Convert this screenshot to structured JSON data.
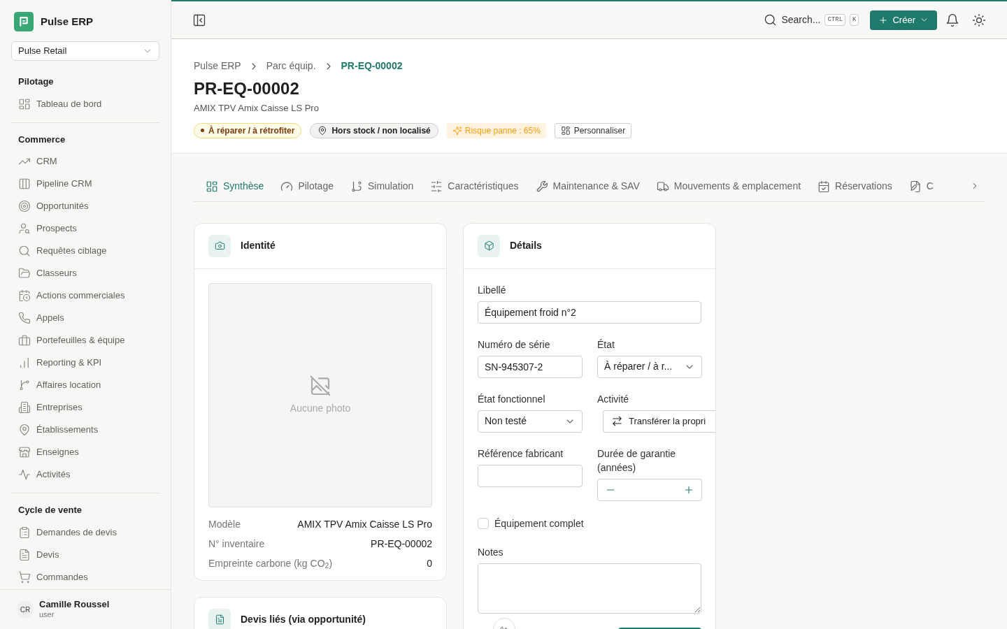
{
  "app": {
    "name": "Pulse ERP"
  },
  "workspace_select": {
    "value": "Pulse Retail"
  },
  "sidebar": {
    "sections": [
      {
        "title": "Pilotage",
        "items": [
          {
            "label": "Tableau de bord"
          }
        ]
      },
      {
        "title": "Commerce",
        "items": [
          {
            "label": "CRM"
          },
          {
            "label": "Pipeline CRM"
          },
          {
            "label": "Opportunités"
          },
          {
            "label": "Prospects"
          },
          {
            "label": "Requêtes ciblage"
          },
          {
            "label": "Classeurs"
          },
          {
            "label": "Actions commerciales"
          },
          {
            "label": "Appels"
          },
          {
            "label": "Portefeuilles & équipe"
          },
          {
            "label": "Reporting & KPI"
          },
          {
            "label": "Affaires location"
          },
          {
            "label": "Entreprises"
          },
          {
            "label": "Établissements"
          },
          {
            "label": "Enseignes"
          },
          {
            "label": "Activités"
          }
        ]
      },
      {
        "title": "Cycle de vente",
        "items": [
          {
            "label": "Demandes de devis"
          },
          {
            "label": "Devis"
          },
          {
            "label": "Commandes"
          }
        ]
      }
    ]
  },
  "user": {
    "initials": "CR",
    "name": "Camille Roussel",
    "role": "user"
  },
  "topbar": {
    "search": "Search...",
    "shortcut": [
      "CTRL",
      "K"
    ],
    "create_button": "Créer"
  },
  "breadcrumb": [
    "Pulse ERP",
    "Parc équip.",
    "PR-EQ-00002"
  ],
  "title": "PR-EQ-00002",
  "subtitle": "AMIX TPV Amix Caisse LS Pro",
  "badges": [
    {
      "kind": "status",
      "label": "À réparer / à rétrofiter"
    },
    {
      "kind": "location",
      "label": "Hors stock / non localisé"
    },
    {
      "kind": "risk",
      "label": "Risque panne : 65%"
    },
    {
      "kind": "action",
      "label": "Personnaliser"
    }
  ],
  "tabs": [
    {
      "label": "Synthèse",
      "selected": true
    },
    {
      "label": "Pilotage",
      "selected": false
    },
    {
      "label": "Simulation",
      "selected": false
    },
    {
      "label": "Caractéristiques",
      "selected": false
    },
    {
      "label": "Maintenance & SAV",
      "selected": false
    },
    {
      "label": "Mouvements & emplacement",
      "selected": false
    },
    {
      "label": "Réservations",
      "selected": false
    },
    {
      "label": "C",
      "selected": false
    }
  ],
  "identity_card": {
    "title": "Identité",
    "photo_placeholder": "Aucune photo",
    "rows": [
      {
        "label": "Modèle",
        "value": "AMIX TPV Amix Caisse LS Pro"
      },
      {
        "label": "N° inventaire",
        "value": "PR-EQ-00002"
      },
      {
        "label": "Empreinte carbone (kg CO$_{2}$)",
        "value": "0"
      }
    ]
  },
  "details_card": {
    "title": "Détails",
    "libelle": {
      "label": "Libellé",
      "value": "Équipement froid n°2"
    },
    "serial": {
      "label": "Numéro de série",
      "value": "SN-945307-2"
    },
    "etat": {
      "label": "État",
      "value": "À réparer / à r..."
    },
    "etat_fonctionnel": {
      "label": "État fonctionnel",
      "value": "Non testé"
    },
    "activite": {
      "label": "Activité",
      "button": "Transférer la propri"
    },
    "reference": {
      "label": "Référence fabricant"
    },
    "garantie": {
      "label": "Durée de garantie (années)"
    },
    "complet": {
      "label": "Équipement complet",
      "checked": false
    },
    "notes": {
      "label": "Notes"
    }
  },
  "linked_card": {
    "title": "Devis liés (via opportunité)"
  }
}
